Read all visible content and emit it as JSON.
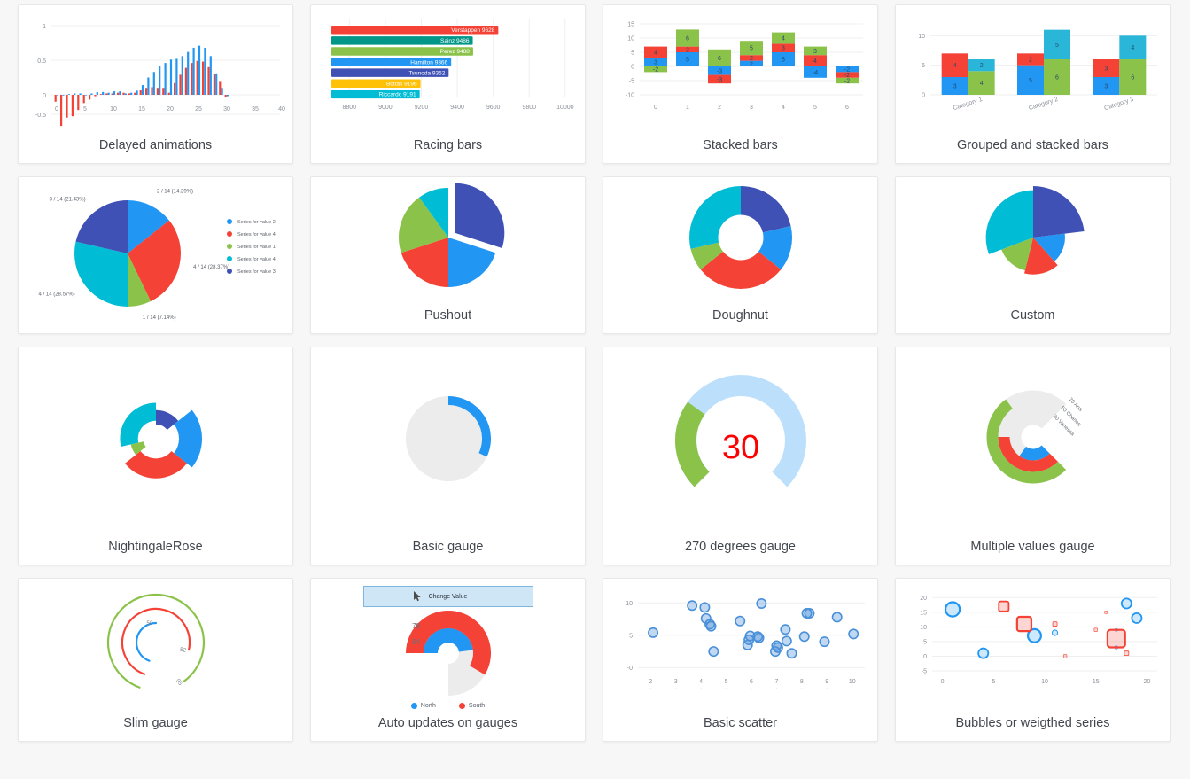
{
  "page": {
    "background": "#f7f7f7",
    "card_background": "#ffffff"
  },
  "palette": {
    "blue": "#2196f3",
    "red": "#f44336",
    "green": "#8bc34a",
    "cyan": "#00bcd4",
    "indigo": "#3f51b5",
    "teal": "#009688",
    "yellow": "#ffc107",
    "light_blue": "#bcdffb",
    "grey": "#ececec",
    "scatter_blue": "#4a90d9",
    "red_value": "#ff0000"
  },
  "cards": [
    {
      "id": "delayed-animations",
      "caption": "Delayed animations"
    },
    {
      "id": "racing-bars",
      "caption": "Racing bars"
    },
    {
      "id": "stacked-bars",
      "caption": "Stacked bars"
    },
    {
      "id": "grouped-stacked-bars",
      "caption": "Grouped and stacked bars"
    },
    {
      "id": "pie",
      "caption": ""
    },
    {
      "id": "pushout",
      "caption": "Pushout"
    },
    {
      "id": "doughnut",
      "caption": "Doughnut"
    },
    {
      "id": "custom",
      "caption": "Custom"
    },
    {
      "id": "nightingale-rose",
      "caption": "NightingaleRose"
    },
    {
      "id": "basic-gauge",
      "caption": "Basic gauge"
    },
    {
      "id": "degrees-gauge",
      "caption": "270 degrees gauge"
    },
    {
      "id": "multiple-values-gauge",
      "caption": "Multiple values gauge"
    },
    {
      "id": "slim-gauge",
      "caption": "Slim gauge"
    },
    {
      "id": "auto-updates-gauges",
      "caption": "Auto updates on gauges"
    },
    {
      "id": "basic-scatter",
      "caption": "Basic scatter"
    },
    {
      "id": "bubbles",
      "caption": "Bubbles or weigthed series"
    }
  ],
  "chart_data": [
    {
      "id": "delayed-animations",
      "type": "bar",
      "title": "Delayed animations",
      "xlabel": "",
      "ylabel": "",
      "xlim": [
        0,
        40
      ],
      "ylim": [
        -0.5,
        1
      ],
      "xticks": [
        "0",
        "5",
        "10",
        "15",
        "20",
        "25",
        "30",
        "35",
        "40"
      ],
      "yticks": [
        "1",
        "0.5",
        "0",
        "-0.5"
      ],
      "grid": true,
      "series": [
        {
          "name": "blue",
          "color": "#2196f3",
          "values": [
            0.0,
            -0.01,
            0.01,
            0.02,
            0.02,
            0.0,
            0.02,
            0.04,
            0.04,
            0.03,
            0.05,
            0.05,
            0.02,
            0.03,
            0.06,
            0.14,
            0.25,
            0.33,
            0.42,
            0.46,
            0.51,
            0.52,
            0.56,
            0.62,
            0.68,
            0.71,
            0.68,
            0.56,
            0.31,
            0.1,
            -0.02
          ]
        },
        {
          "name": "red",
          "color": "#f44336",
          "values": [
            -0.1,
            -0.45,
            -0.33,
            -0.31,
            -0.22,
            -0.12,
            -0.07,
            -0.02,
            0.01,
            0.02,
            0.02,
            0.03,
            0.03,
            0.02,
            0.03,
            0.07,
            0.1,
            0.11,
            0.1,
            0.1,
            0.03,
            0.17,
            0.29,
            0.39,
            0.46,
            0.49,
            0.48,
            0.4,
            0.3,
            0.2,
            -0.03
          ]
        }
      ]
    },
    {
      "id": "racing-bars",
      "type": "bar",
      "orientation": "horizontal",
      "title": "Racing bars",
      "xlim": [
        8700,
        10050
      ],
      "xticks": [
        "8800",
        "9000",
        "9200",
        "9400",
        "9600",
        "9800",
        "10000"
      ],
      "grid": true,
      "categories": [
        "Verstappen",
        "Sainz",
        "Perez",
        "Hamilton",
        "Tsunoda",
        "Bottas",
        "Riccardo"
      ],
      "values": [
        9628,
        9486,
        9488,
        9366,
        9352,
        9196,
        9191
      ],
      "labels": [
        "Verstappen 9628",
        "Sainz 9486",
        "Perez 9488",
        "Hamilton 9366",
        "Tsunoda 9352",
        "Bottas 9196",
        "Riccardo 9191"
      ],
      "colors": [
        "#f44336",
        "#009688",
        "#8bc34a",
        "#2196f3",
        "#3f51b5",
        "#ffc107",
        "#00bcd4"
      ]
    },
    {
      "id": "stacked-bars",
      "type": "bar",
      "stacked": true,
      "title": "Stacked bars",
      "ylim": [
        -10,
        15
      ],
      "yticks": [
        "15",
        "10",
        "5",
        "0",
        "-5",
        "-10"
      ],
      "categories": [
        "0",
        "1",
        "2",
        "3",
        "4",
        "5",
        "6"
      ],
      "grid": true,
      "series": [
        {
          "name": "blue",
          "color": "#2196f3",
          "values": [
            3,
            5,
            -3,
            2,
            5,
            -4,
            -2
          ]
        },
        {
          "name": "red",
          "color": "#f44336",
          "values": [
            4,
            2,
            -3,
            2,
            3,
            4,
            -2
          ]
        },
        {
          "name": "green",
          "color": "#8bc34a",
          "values": [
            -2,
            6,
            6,
            5,
            4,
            3,
            -2
          ]
        }
      ]
    },
    {
      "id": "grouped-stacked-bars",
      "type": "bar",
      "stacked": true,
      "grouped": true,
      "title": "Grouped and stacked bars",
      "ylim": [
        0,
        12
      ],
      "yticks": [
        "10",
        "5",
        "0"
      ],
      "categories": [
        "Category 1",
        "Category 2",
        "Category 3"
      ],
      "grid": true,
      "groups": [
        {
          "name": "stack-a",
          "series": [
            {
              "name": "blue",
              "color": "#2196f3",
              "values": [
                3,
                5,
                3
              ]
            },
            {
              "name": "red",
              "color": "#f44336",
              "values": [
                4,
                2,
                3
              ]
            }
          ]
        },
        {
          "name": "stack-b",
          "series": [
            {
              "name": "green",
              "color": "#8bc34a",
              "values": [
                4,
                6,
                6
              ]
            },
            {
              "name": "cyan",
              "color": "#29b6d8",
              "values": [
                2,
                5,
                4
              ]
            }
          ]
        }
      ]
    },
    {
      "id": "pie",
      "type": "pie",
      "title": "",
      "legend_position": "right",
      "slices": [
        {
          "label": "Series for value 2",
          "value": 2,
          "percent": "14.29%",
          "data_label": "2 / 14 (14.29%)",
          "color": "#2196f3"
        },
        {
          "label": "Series for value 4",
          "value": 4,
          "percent": "28.37%",
          "data_label": "4 / 14 (28.37%)",
          "color": "#f44336"
        },
        {
          "label": "Series for value 1",
          "value": 1,
          "percent": "7.14%",
          "data_label": "1 / 14 (7.14%)",
          "color": "#8bc34a"
        },
        {
          "label": "Series for value 4",
          "value": 4,
          "percent": "28.57%",
          "data_label": "4 / 14 (28.57%)",
          "color": "#00bcd4"
        },
        {
          "label": "Series for value 3",
          "value": 3,
          "percent": "21.43%",
          "data_label": "3 / 14 (21.43%)",
          "color": "#3f51b5"
        }
      ]
    },
    {
      "id": "pushout",
      "type": "pie",
      "title": "Pushout",
      "slices": [
        {
          "value": 3,
          "color": "#3f51b5",
          "exploded": true
        },
        {
          "value": 2,
          "color": "#2196f3",
          "exploded": false
        },
        {
          "value": 2,
          "color": "#f44336",
          "exploded": false
        },
        {
          "value": 2,
          "color": "#8bc34a",
          "exploded": false
        },
        {
          "value": 1,
          "color": "#00bcd4",
          "exploded": false
        }
      ]
    },
    {
      "id": "doughnut",
      "type": "pie",
      "doughnut": true,
      "title": "Doughnut",
      "slices": [
        {
          "value": 3,
          "color": "#3f51b5"
        },
        {
          "value": 2,
          "color": "#2196f3"
        },
        {
          "value": 4,
          "color": "#f44336"
        },
        {
          "value": 1,
          "color": "#8bc34a"
        },
        {
          "value": 4,
          "color": "#00bcd4"
        }
      ]
    },
    {
      "id": "custom",
      "type": "pie",
      "title": "Custom",
      "slices": [
        {
          "value": 3,
          "color": "#3f51b5",
          "radius": 1.0
        },
        {
          "value": 2,
          "color": "#2196f3",
          "radius": 0.62
        },
        {
          "value": 2,
          "color": "#f44336",
          "radius": 0.72
        },
        {
          "value": 2,
          "color": "#8bc34a",
          "radius": 0.66
        },
        {
          "value": 4,
          "color": "#00bcd4",
          "radius": 0.92
        }
      ]
    },
    {
      "id": "nightingale-rose",
      "type": "pie",
      "doughnut": true,
      "title": "NightingaleRose",
      "slices": [
        {
          "value": 2,
          "color": "#3f51b5",
          "radius": 0.62
        },
        {
          "value": 3,
          "color": "#2196f3",
          "radius": 1.0
        },
        {
          "value": 4,
          "color": "#f44336",
          "radius": 0.86
        },
        {
          "value": 1,
          "color": "#8bc34a",
          "radius": 0.56
        },
        {
          "value": 4,
          "color": "#00bcd4",
          "radius": 0.78
        }
      ]
    },
    {
      "id": "basic-gauge",
      "type": "pie",
      "title": "Basic gauge",
      "value": 32,
      "max": 100,
      "arc_color": "#2196f3",
      "track_color": "#ececec"
    },
    {
      "id": "degrees-gauge",
      "type": "pie",
      "title": "270 degrees gauge",
      "value": 30,
      "max": 100,
      "display_value": "30",
      "sweep_degrees": 270,
      "arc_color": "#8bc34a",
      "track_color": "#bcdffb"
    },
    {
      "id": "multiple-values-gauge",
      "type": "pie",
      "title": "Multiple values gauge",
      "track_color": "#ececec",
      "values": [
        {
          "label": "30 Vanessa",
          "value": 30,
          "color": "#2196f3"
        },
        {
          "label": "50 Charles",
          "value": 50,
          "color": "#f44336"
        },
        {
          "label": "70 Ana",
          "value": 70,
          "color": "#8bc34a"
        }
      ]
    },
    {
      "id": "slim-gauge",
      "type": "pie",
      "title": "Slim gauge",
      "values": [
        {
          "label": "50",
          "value": 50,
          "color": "#2196f3"
        },
        {
          "label": "82",
          "value": 82,
          "color": "#f44336"
        },
        {
          "label": "95",
          "value": 95,
          "color": "#8bc34a"
        }
      ]
    },
    {
      "id": "auto-updates-gauges",
      "type": "pie",
      "title": "Auto updates on gauges",
      "button_label": "Change Value",
      "values": [
        {
          "label": "64",
          "value": 64,
          "color": "#2196f3",
          "series": "North"
        },
        {
          "label": "78",
          "value": 78,
          "color": "#f44336",
          "series": "South"
        }
      ],
      "legend": [
        {
          "label": "North",
          "color": "#2196f3"
        },
        {
          "label": "South",
          "color": "#f44336"
        }
      ],
      "track_color": "#ececec"
    },
    {
      "id": "basic-scatter",
      "type": "scatter",
      "title": "Basic scatter",
      "xlim": [
        1.5,
        10.5
      ],
      "ylim": [
        -0.5,
        11
      ],
      "xticks": [
        "2",
        "3",
        "4",
        "5",
        "6",
        "7",
        "8",
        "9",
        "10"
      ],
      "yticks": [
        "10",
        "5",
        "-0"
      ],
      "grid": true,
      "color": "#4a90d9",
      "points": [
        [
          2.1,
          5.4
        ],
        [
          3.65,
          9.6
        ],
        [
          4.15,
          9.3
        ],
        [
          4.2,
          7.6
        ],
        [
          4.35,
          6.7
        ],
        [
          4.4,
          6.4
        ],
        [
          4.5,
          2.5
        ],
        [
          5.55,
          7.2
        ],
        [
          5.95,
          4.9
        ],
        [
          5.9,
          4.3
        ],
        [
          5.85,
          3.5
        ],
        [
          6.25,
          4.8
        ],
        [
          6.3,
          4.6
        ],
        [
          6.4,
          9.9
        ],
        [
          7.0,
          3.4
        ],
        [
          7.05,
          3.1
        ],
        [
          6.95,
          2.5
        ],
        [
          7.35,
          5.9
        ],
        [
          7.4,
          4.1
        ],
        [
          7.6,
          2.2
        ],
        [
          8.2,
          8.4
        ],
        [
          8.3,
          8.4
        ],
        [
          8.1,
          4.8
        ],
        [
          8.9,
          4.0
        ],
        [
          9.4,
          7.8
        ],
        [
          10.05,
          5.2
        ]
      ]
    },
    {
      "id": "bubbles",
      "type": "scatter",
      "title": "Bubbles or weigthed series",
      "xlim": [
        -1,
        21
      ],
      "ylim": [
        -5,
        21
      ],
      "xticks": [
        "0",
        "5",
        "10",
        "15",
        "20"
      ],
      "yticks": [
        "20",
        "15",
        "10",
        "5",
        "0",
        "-5"
      ],
      "grid": true,
      "series": [
        {
          "name": "blue-circles",
          "color": "#2196f3",
          "marker": "circle",
          "points": [
            [
              1,
              16,
              13
            ],
            [
              4,
              1,
              9
            ],
            [
              9,
              7,
              12
            ],
            [
              11,
              8,
              5
            ],
            [
              17,
              9,
              2
            ],
            [
              17,
              3,
              3
            ],
            [
              18,
              18,
              9
            ],
            [
              19,
              13,
              9
            ]
          ]
        },
        {
          "name": "red-squares",
          "color": "#f44336",
          "marker": "square",
          "points": [
            [
              6,
              17,
              9
            ],
            [
              8,
              11,
              13
            ],
            [
              11,
              11,
              4
            ],
            [
              12,
              0,
              3
            ],
            [
              15,
              9,
              3
            ],
            [
              16,
              15,
              2
            ],
            [
              17,
              6,
              16
            ],
            [
              18,
              1,
              4
            ]
          ]
        }
      ]
    }
  ]
}
